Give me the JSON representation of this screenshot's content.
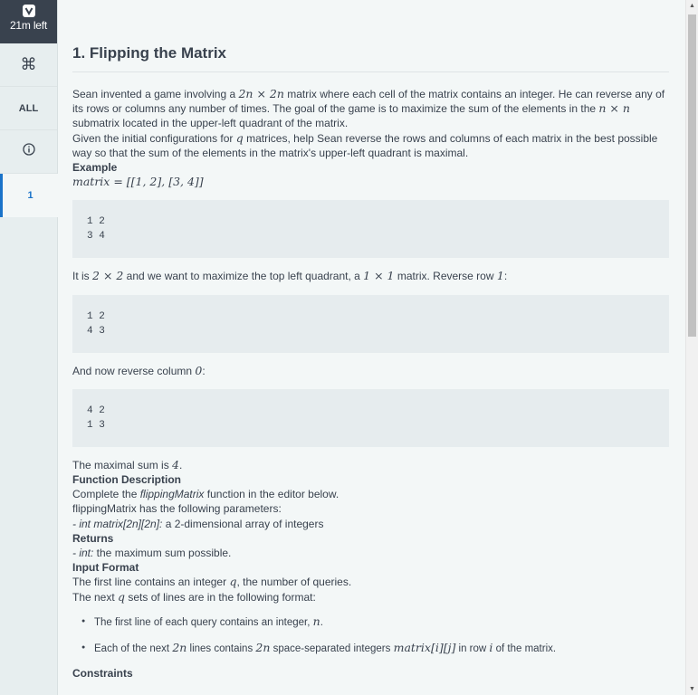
{
  "sidebar": {
    "logo_icon": "hackerrank-logo-icon",
    "timer": "21m left",
    "cmd_glyph": "⌘",
    "all_label": "ALL",
    "info_glyph": "i",
    "question_number": "1"
  },
  "problem": {
    "title": "1. Flipping the Matrix",
    "intro_1a": "Sean invented a game involving a ",
    "intro_1_math": "2n × 2n",
    "intro_1b": " matrix where each cell of the matrix contains an integer. He can reverse any of its rows or columns any number of times. The goal of the game is to maximize the sum of the elements in the ",
    "intro_1_math2": "n × n",
    "intro_1c": " submatrix located in the upper-left quadrant of the matrix.",
    "intro_2a": "Given the initial configurations for ",
    "intro_2_math": "q",
    "intro_2b": " matrices, help Sean reverse the rows and columns of each matrix in the best possible way so that the sum of the elements in the matrix's upper-left quadrant is maximal.",
    "example_heading": "Example",
    "example_math": "matrix = [[1, 2], [3, 4]]",
    "code_1_line_1": "1 2",
    "code_1_line_2": "3 4",
    "text_2a": "It is ",
    "text_2_math1": "2 × 2",
    "text_2b": " and we want to maximize the top left quadrant, a ",
    "text_2_math2": "1 × 1",
    "text_2c": " matrix. Reverse row ",
    "text_2_math3": "1",
    "text_2d": ":",
    "code_2_line_1": "1 2",
    "code_2_line_2": "4 3",
    "text_3a": "And now reverse column ",
    "text_3_math": "0",
    "text_3b": ":",
    "code_3_line_1": "4 2",
    "code_3_line_2": "1 3",
    "maximal_a": "The maximal sum is ",
    "maximal_math": "4",
    "maximal_b": ".",
    "function_heading": "Function Description",
    "function_desc_a": "Complete the ",
    "function_desc_name": "flippingMatrix",
    "function_desc_b": " function in the editor below.",
    "params_intro": "flippingMatrix has the following parameters:",
    "param_1_type": "- int matrix[2n][2n]:",
    "param_1_desc": " a 2-dimensional array of integers",
    "returns_heading": "Returns",
    "returns_type": "- int:",
    "returns_desc": " the maximum sum possible.",
    "input_heading": "Input Format",
    "input_1a": "The first line contains an integer ",
    "input_1_math": "q",
    "input_1b": ", the number of queries.",
    "input_2a": "The next ",
    "input_2_math": "q",
    "input_2b": " sets of lines are in the following format:",
    "bullet_1a": "The first line of each query contains an integer, ",
    "bullet_1_math": "n",
    "bullet_1b": ".",
    "bullet_2a": "Each of the next ",
    "bullet_2_math1": "2n",
    "bullet_2b": " lines contains ",
    "bullet_2_math2": "2n",
    "bullet_2c": " space-separated integers ",
    "bullet_2_math3": "matrix[i][j]",
    "bullet_2d": " in row ",
    "bullet_2_math4": "i",
    "bullet_2e": " of the matrix.",
    "constraints_heading": "Constraints"
  },
  "colors": {
    "accent": "#1a73c9",
    "timer_bg": "#39424e",
    "code_bg": "#e6ecee"
  }
}
